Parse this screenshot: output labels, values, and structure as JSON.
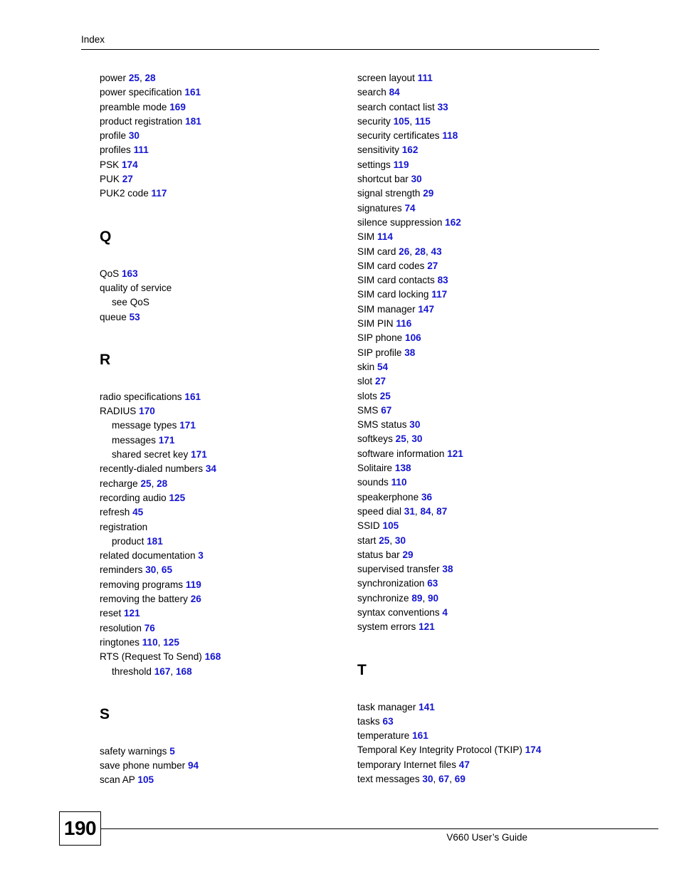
{
  "header": {
    "title": "Index"
  },
  "footer": {
    "page_number": "190",
    "guide_text": "V660 User’s Guide"
  },
  "colors": {
    "page_link": "#1414d2",
    "text": "#000000"
  },
  "columns": {
    "left": [
      {
        "type": "entry",
        "text": "power ",
        "pages": [
          "25",
          "28"
        ]
      },
      {
        "type": "entry",
        "text": "power specification ",
        "pages": [
          "161"
        ]
      },
      {
        "type": "entry",
        "text": "preamble mode ",
        "pages": [
          "169"
        ]
      },
      {
        "type": "entry",
        "text": "product registration ",
        "pages": [
          "181"
        ]
      },
      {
        "type": "entry",
        "text": "profile ",
        "pages": [
          "30"
        ]
      },
      {
        "type": "entry",
        "text": "profiles ",
        "pages": [
          "111"
        ]
      },
      {
        "type": "entry",
        "text": "PSK ",
        "pages": [
          "174"
        ]
      },
      {
        "type": "entry",
        "text": "PUK ",
        "pages": [
          "27"
        ]
      },
      {
        "type": "entry",
        "text": "PUK2 code ",
        "pages": [
          "117"
        ]
      },
      {
        "type": "letter",
        "text": "Q"
      },
      {
        "type": "entry",
        "text": "QoS ",
        "pages": [
          "163"
        ]
      },
      {
        "type": "entry",
        "text": "quality of service",
        "pages": []
      },
      {
        "type": "subentry",
        "text": "see QoS",
        "pages": []
      },
      {
        "type": "entry",
        "text": "queue ",
        "pages": [
          "53"
        ]
      },
      {
        "type": "letter",
        "text": "R"
      },
      {
        "type": "entry",
        "text": "radio specifications ",
        "pages": [
          "161"
        ]
      },
      {
        "type": "entry",
        "text": "RADIUS ",
        "pages": [
          "170"
        ]
      },
      {
        "type": "subentry",
        "text": "message types ",
        "pages": [
          "171"
        ]
      },
      {
        "type": "subentry",
        "text": "messages ",
        "pages": [
          "171"
        ]
      },
      {
        "type": "subentry",
        "text": "shared secret key ",
        "pages": [
          "171"
        ]
      },
      {
        "type": "entry",
        "text": "recently-dialed numbers ",
        "pages": [
          "34"
        ]
      },
      {
        "type": "entry",
        "text": "recharge ",
        "pages": [
          "25",
          "28"
        ]
      },
      {
        "type": "entry",
        "text": "recording audio ",
        "pages": [
          "125"
        ]
      },
      {
        "type": "entry",
        "text": "refresh ",
        "pages": [
          "45"
        ]
      },
      {
        "type": "entry",
        "text": "registration",
        "pages": []
      },
      {
        "type": "subentry",
        "text": "product ",
        "pages": [
          "181"
        ]
      },
      {
        "type": "entry",
        "text": "related documentation ",
        "pages": [
          "3"
        ]
      },
      {
        "type": "entry",
        "text": "reminders ",
        "pages": [
          "30",
          "65"
        ]
      },
      {
        "type": "entry",
        "text": "removing programs ",
        "pages": [
          "119"
        ]
      },
      {
        "type": "entry",
        "text": "removing the battery ",
        "pages": [
          "26"
        ]
      },
      {
        "type": "entry",
        "text": "reset ",
        "pages": [
          "121"
        ]
      },
      {
        "type": "entry",
        "text": "resolution ",
        "pages": [
          "76"
        ]
      },
      {
        "type": "entry",
        "text": "ringtones ",
        "pages": [
          "110",
          "125"
        ]
      },
      {
        "type": "entry",
        "text": "RTS (Request To Send) ",
        "pages": [
          "168"
        ]
      },
      {
        "type": "subentry",
        "text": "threshold ",
        "pages": [
          "167",
          "168"
        ]
      },
      {
        "type": "letter",
        "text": "S"
      },
      {
        "type": "entry",
        "text": "safety warnings ",
        "pages": [
          "5"
        ]
      },
      {
        "type": "entry",
        "text": "save phone number ",
        "pages": [
          "94"
        ]
      },
      {
        "type": "entry",
        "text": "scan AP ",
        "pages": [
          "105"
        ]
      }
    ],
    "right": [
      {
        "type": "entry",
        "text": "screen layout ",
        "pages": [
          "111"
        ]
      },
      {
        "type": "entry",
        "text": "search ",
        "pages": [
          "84"
        ]
      },
      {
        "type": "entry",
        "text": "search contact list ",
        "pages": [
          "33"
        ]
      },
      {
        "type": "entry",
        "text": "security ",
        "pages": [
          "105",
          "115"
        ]
      },
      {
        "type": "entry",
        "text": "security certificates ",
        "pages": [
          "118"
        ]
      },
      {
        "type": "entry",
        "text": "sensitivity ",
        "pages": [
          "162"
        ]
      },
      {
        "type": "entry",
        "text": "settings ",
        "pages": [
          "119"
        ]
      },
      {
        "type": "entry",
        "text": "shortcut bar ",
        "pages": [
          "30"
        ]
      },
      {
        "type": "entry",
        "text": "signal strength ",
        "pages": [
          "29"
        ]
      },
      {
        "type": "entry",
        "text": "signatures ",
        "pages": [
          "74"
        ]
      },
      {
        "type": "entry",
        "text": "silence suppression ",
        "pages": [
          "162"
        ]
      },
      {
        "type": "entry",
        "text": "SIM ",
        "pages": [
          "114"
        ]
      },
      {
        "type": "entry",
        "text": "SIM card ",
        "pages": [
          "26",
          "28",
          "43"
        ]
      },
      {
        "type": "entry",
        "text": "SIM card codes ",
        "pages": [
          "27"
        ]
      },
      {
        "type": "entry",
        "text": "SIM card contacts ",
        "pages": [
          "83"
        ]
      },
      {
        "type": "entry",
        "text": "SIM card locking ",
        "pages": [
          "117"
        ]
      },
      {
        "type": "entry",
        "text": "SIM manager ",
        "pages": [
          "147"
        ]
      },
      {
        "type": "entry",
        "text": "SIM PIN ",
        "pages": [
          "116"
        ]
      },
      {
        "type": "entry",
        "text": "SIP phone ",
        "pages": [
          "106"
        ]
      },
      {
        "type": "entry",
        "text": "SIP profile ",
        "pages": [
          "38"
        ]
      },
      {
        "type": "entry",
        "text": "skin ",
        "pages": [
          "54"
        ]
      },
      {
        "type": "entry",
        "text": "slot ",
        "pages": [
          "27"
        ]
      },
      {
        "type": "entry",
        "text": "slots ",
        "pages": [
          "25"
        ]
      },
      {
        "type": "entry",
        "text": "SMS ",
        "pages": [
          "67"
        ]
      },
      {
        "type": "entry",
        "text": "SMS status ",
        "pages": [
          "30"
        ]
      },
      {
        "type": "entry",
        "text": "softkeys ",
        "pages": [
          "25",
          "30"
        ]
      },
      {
        "type": "entry",
        "text": "software information ",
        "pages": [
          "121"
        ]
      },
      {
        "type": "entry",
        "text": "Solitaire ",
        "pages": [
          "138"
        ]
      },
      {
        "type": "entry",
        "text": "sounds ",
        "pages": [
          "110"
        ]
      },
      {
        "type": "entry",
        "text": "speakerphone ",
        "pages": [
          "36"
        ]
      },
      {
        "type": "entry",
        "text": "speed dial ",
        "pages": [
          "31",
          "84",
          "87"
        ]
      },
      {
        "type": "entry",
        "text": "SSID ",
        "pages": [
          "105"
        ]
      },
      {
        "type": "entry",
        "text": "start ",
        "pages": [
          "25",
          "30"
        ]
      },
      {
        "type": "entry",
        "text": "status bar ",
        "pages": [
          "29"
        ]
      },
      {
        "type": "entry",
        "text": "supervised transfer ",
        "pages": [
          "38"
        ]
      },
      {
        "type": "entry",
        "text": "synchronization ",
        "pages": [
          "63"
        ]
      },
      {
        "type": "entry",
        "text": "synchronize ",
        "pages": [
          "89",
          "90"
        ]
      },
      {
        "type": "entry",
        "text": "syntax conventions ",
        "pages": [
          "4"
        ]
      },
      {
        "type": "entry",
        "text": "system errors ",
        "pages": [
          "121"
        ]
      },
      {
        "type": "letter",
        "text": "T"
      },
      {
        "type": "entry",
        "text": "task manager ",
        "pages": [
          "141"
        ]
      },
      {
        "type": "entry",
        "text": "tasks ",
        "pages": [
          "63"
        ]
      },
      {
        "type": "entry",
        "text": "temperature ",
        "pages": [
          "161"
        ]
      },
      {
        "type": "entry",
        "text": "Temporal Key Integrity Protocol (TKIP) ",
        "pages": [
          "174"
        ]
      },
      {
        "type": "entry",
        "text": "temporary Internet files ",
        "pages": [
          "47"
        ]
      },
      {
        "type": "entry",
        "text": "text messages ",
        "pages": [
          "30",
          "67",
          "69"
        ]
      }
    ]
  }
}
